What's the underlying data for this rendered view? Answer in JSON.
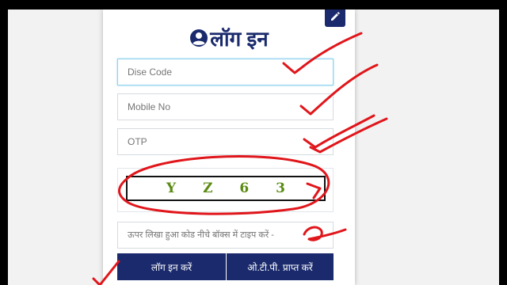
{
  "login": {
    "title": "लॉग इन",
    "fields": {
      "dise_code_placeholder": "Dise Code",
      "mobile_placeholder": "Mobile No",
      "otp_placeholder": "OTP",
      "captcha_hint_placeholder": "ऊपर लिखा हुआ कोड नीचे बॉक्स में टाइप करें -"
    },
    "captcha": {
      "code": "Y Z 6 3"
    },
    "buttons": {
      "login_label": "लॉग इन करें",
      "otp_label": "ओ.टी.पी. प्राप्त करें"
    }
  },
  "colors": {
    "primary": "#1a2a6c",
    "focus_border": "#8fd2ee",
    "captcha_text": "#5a8a12",
    "annotation_red": "#e0161b"
  },
  "icons": {
    "title_icon": "user-circle-icon",
    "edit_icon": "pencil-icon"
  }
}
